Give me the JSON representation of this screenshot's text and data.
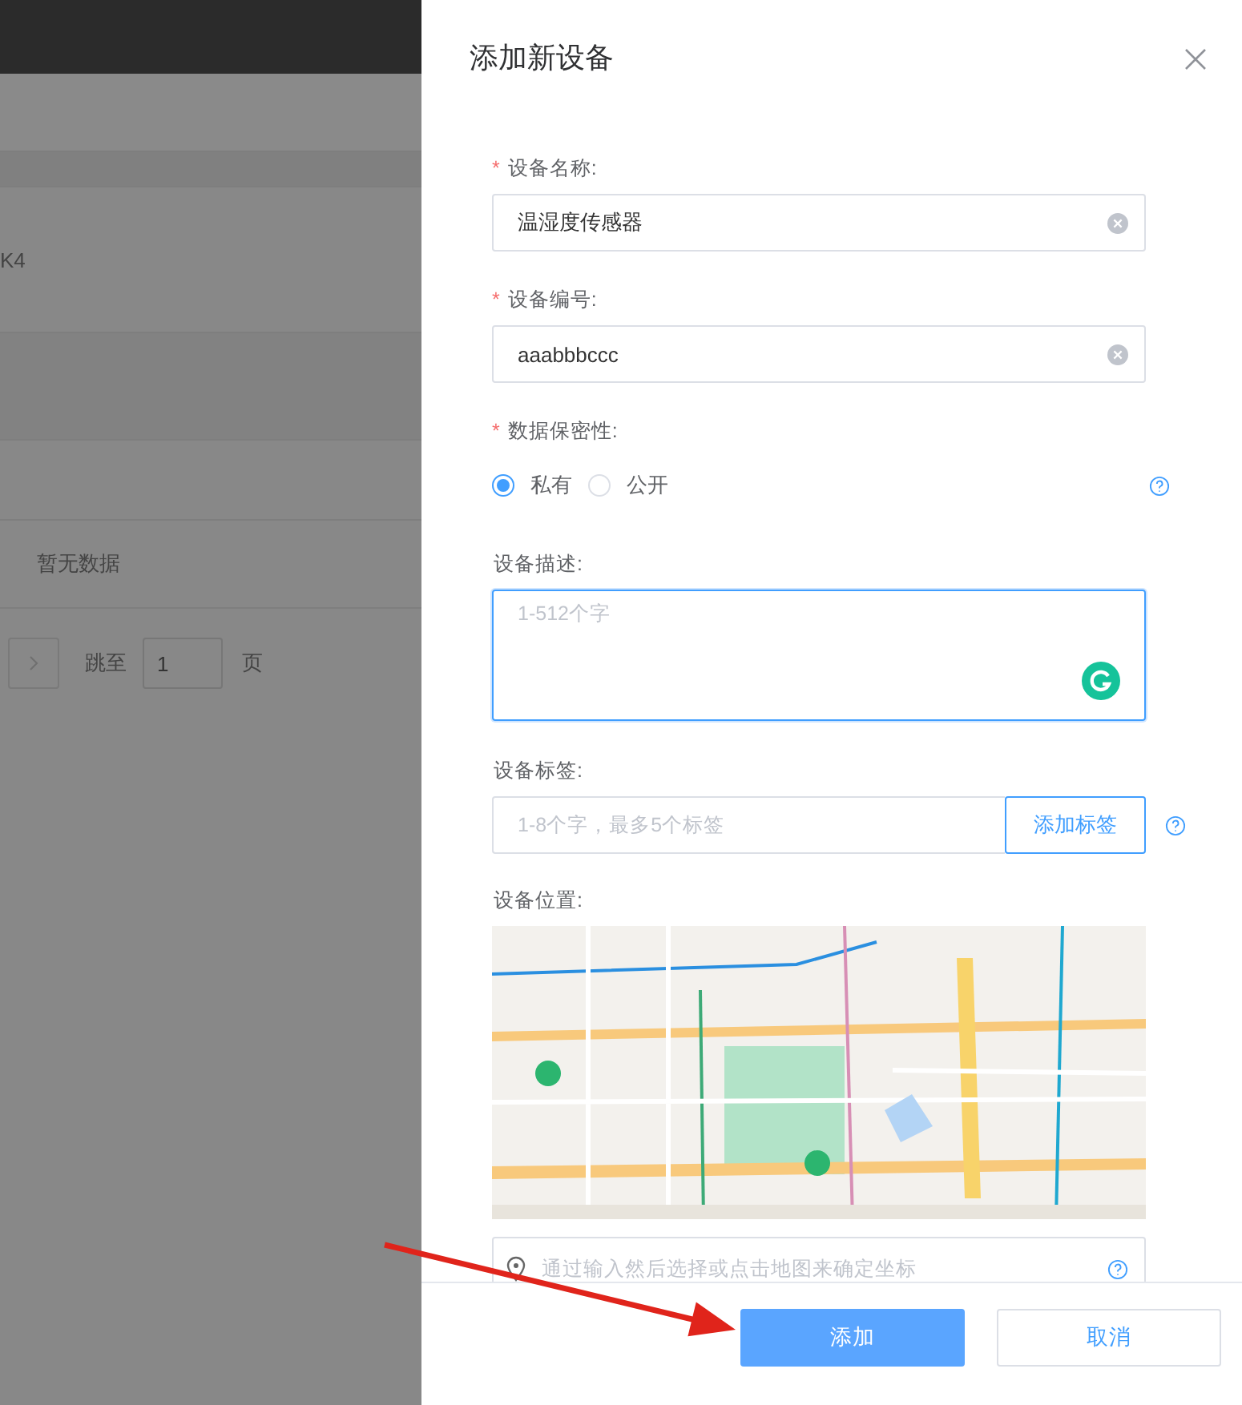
{
  "background_page": {
    "cell_text": "K4",
    "empty_text": "暂无数据",
    "pagination": {
      "jump_label": "跳至",
      "page_value": "1",
      "page_suffix": "页"
    }
  },
  "drawer": {
    "title": "添加新设备",
    "fields": [
      {
        "kind": "input",
        "label": "设备名称:",
        "required_mark": "*",
        "value": "温湿度传感器"
      },
      {
        "kind": "input",
        "label": "设备编号:",
        "required_mark": "*",
        "value": "aaabbbccc"
      },
      {
        "kind": "radio",
        "label": "数据保密性:",
        "required_mark": "*",
        "options": [
          {
            "label": "私有",
            "selected": true
          },
          {
            "label": "公开",
            "selected": false
          }
        ]
      },
      {
        "kind": "textarea",
        "label": "设备描述:",
        "placeholder": "1-512个字"
      },
      {
        "kind": "tags",
        "label": "设备标签:",
        "placeholder": "1-8个字，最多5个标签",
        "button": "添加标签"
      },
      {
        "kind": "map",
        "label": "设备位置:"
      },
      {
        "kind": "location",
        "placeholder": "通过输入然后选择或点击地图来确定坐标"
      }
    ],
    "buttons": [
      {
        "label": "添加",
        "kind": "primary"
      },
      {
        "label": "取消",
        "kind": "default"
      }
    ]
  }
}
